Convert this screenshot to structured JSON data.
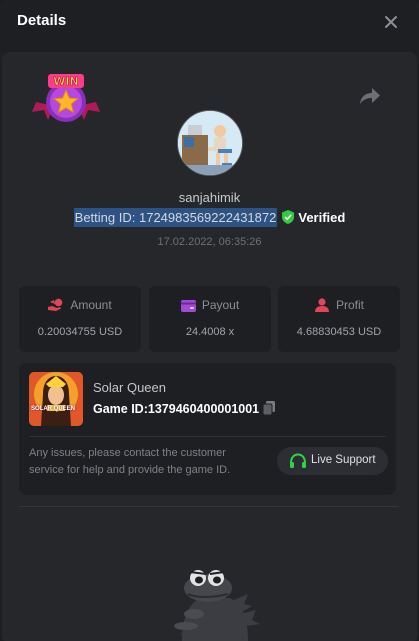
{
  "header": {
    "title": "Details"
  },
  "bet": {
    "username": "sanjahimik",
    "betting_id_label": "Betting ID:",
    "betting_id": "1724983569222431872",
    "verified_label": "Verified",
    "datetime": "17.02.2022, 06:35:26"
  },
  "stats": {
    "amount_label": "Amount",
    "amount_value": "0.20034755 USD",
    "payout_label": "Payout",
    "payout_value": "24.4008 x",
    "profit_label": "Profit",
    "profit_value": "4.68830453 USD"
  },
  "game": {
    "name": "Solar Queen",
    "id_label": "Game ID:",
    "id": "1379460400001001",
    "issues_text": "Any issues, please contact the customer service for help and provide the game ID.",
    "support_label": "Live Support",
    "thumbnail_text": "SOLAR QUEEN"
  },
  "badge": {
    "text": "WIN"
  },
  "colors": {
    "background": "#1e1f22",
    "card": "#1e1f23",
    "verified": "#2ecc40",
    "amount_icon": "#e0455a",
    "payout_icon": "#a24ad8",
    "profit_icon": "#e0455a",
    "support_icon": "#35d04a",
    "selection": "#2d5384"
  },
  "icons": {
    "close": "close-icon",
    "share": "share-icon",
    "verified": "shield-check-icon",
    "amount": "hand-coin-icon",
    "payout": "wallet-icon",
    "profit": "user-profit-icon",
    "copy": "copy-icon",
    "support": "headset-icon"
  }
}
